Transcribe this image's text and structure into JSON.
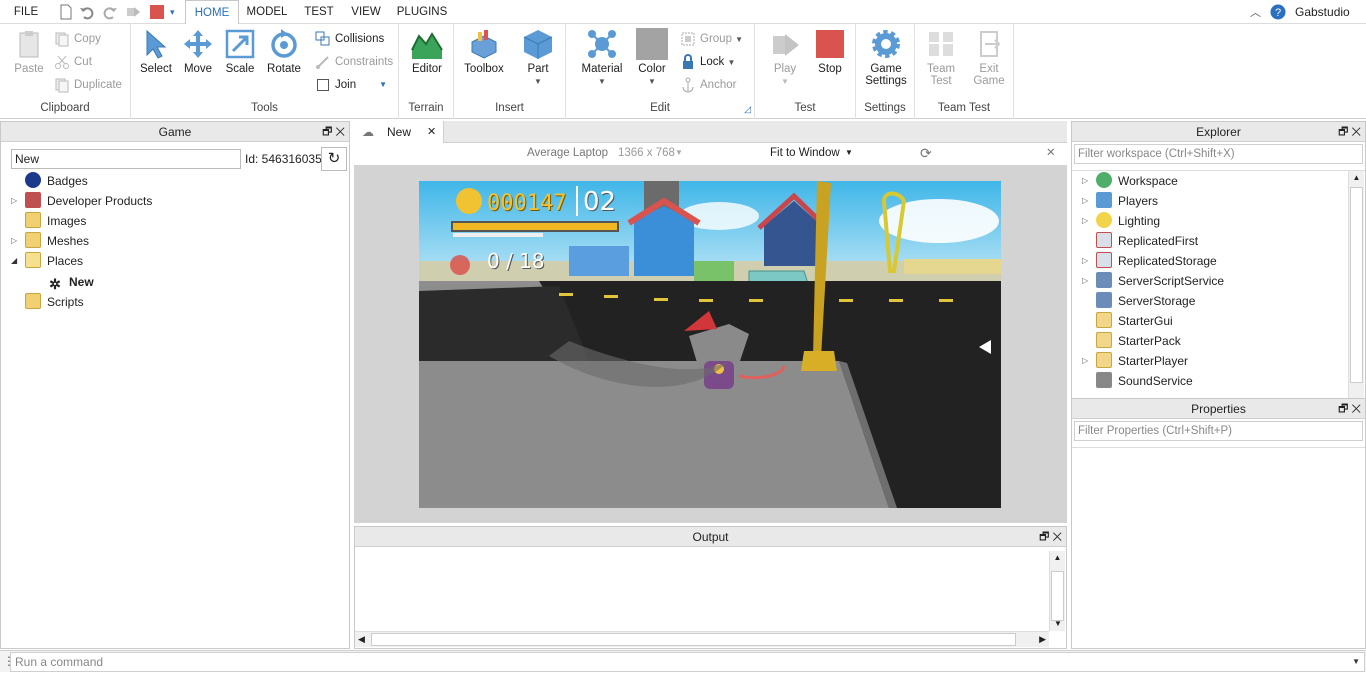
{
  "menubar": {
    "tabs": [
      {
        "label": "FILE"
      },
      {
        "label": "HOME"
      },
      {
        "label": "MODEL"
      },
      {
        "label": "TEST"
      },
      {
        "label": "VIEW"
      },
      {
        "label": "PLUGINS"
      }
    ],
    "user": "Gabstudio"
  },
  "ribbon": {
    "clipboard": {
      "paste": "Paste",
      "copy": "Copy",
      "cut": "Cut",
      "duplicate": "Duplicate",
      "label": "Clipboard"
    },
    "tools": {
      "select": "Select",
      "move": "Move",
      "scale": "Scale",
      "rotate": "Rotate",
      "collisions": "Collisions",
      "constraints": "Constraints",
      "join": "Join",
      "label": "Tools"
    },
    "terrain": {
      "editor": "Editor",
      "label": "Terrain"
    },
    "insert": {
      "toolbox": "Toolbox",
      "part": "Part",
      "label": "Insert"
    },
    "edit": {
      "material": "Material",
      "color": "Color",
      "group": "Group",
      "lock": "Lock",
      "anchor": "Anchor",
      "label": "Edit"
    },
    "test": {
      "play": "Play",
      "stop": "Stop",
      "label": "Test"
    },
    "settings": {
      "game_settings_1": "Game",
      "game_settings_2": "Settings",
      "label": "Settings"
    },
    "teamtest": {
      "team_test_1": "Team",
      "team_test_2": "Test",
      "exit_game_1": "Exit",
      "exit_game_2": "Game",
      "label": "Team Test"
    }
  },
  "game_panel": {
    "title": "Game",
    "search_value": "New",
    "id_label": "Id: 546316035",
    "items": [
      {
        "label": "Badges"
      },
      {
        "label": "Developer Products"
      },
      {
        "label": "Images"
      },
      {
        "label": "Meshes"
      },
      {
        "label": "Places"
      },
      {
        "label": "New"
      },
      {
        "label": "Scripts"
      }
    ]
  },
  "viewport": {
    "tab_label": "New",
    "device": "Average Laptop",
    "resolution": "1366 x 768",
    "fit": "Fit to Window",
    "hud": {
      "coins": "000147",
      "lives": "02",
      "count": "0 / 18"
    }
  },
  "output": {
    "title": "Output"
  },
  "explorer": {
    "title": "Explorer",
    "filter_placeholder": "Filter workspace (Ctrl+Shift+X)",
    "items": [
      {
        "label": "Workspace"
      },
      {
        "label": "Players"
      },
      {
        "label": "Lighting"
      },
      {
        "label": "ReplicatedFirst"
      },
      {
        "label": "ReplicatedStorage"
      },
      {
        "label": "ServerScriptService"
      },
      {
        "label": "ServerStorage"
      },
      {
        "label": "StarterGui"
      },
      {
        "label": "StarterPack"
      },
      {
        "label": "StarterPlayer"
      },
      {
        "label": "SoundService"
      }
    ]
  },
  "properties": {
    "title": "Properties",
    "filter_placeholder": "Filter Properties (Ctrl+Shift+P)"
  },
  "command": {
    "placeholder": "Run a command"
  }
}
